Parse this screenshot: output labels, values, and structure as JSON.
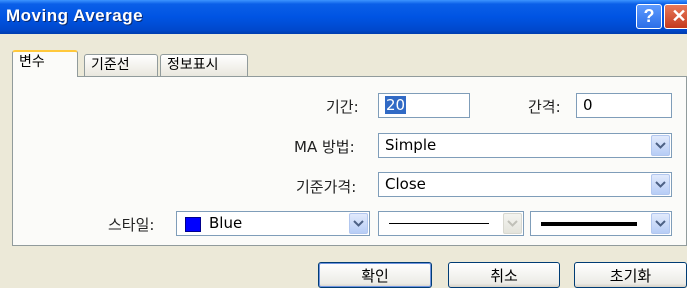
{
  "window": {
    "title": "Moving Average",
    "help_label": "?",
    "close_label": "✕"
  },
  "tabs": [
    {
      "label": "변수",
      "active": true
    },
    {
      "label": "기준선",
      "active": false
    },
    {
      "label": "정보표시",
      "active": false
    }
  ],
  "form": {
    "period_label": "기간:",
    "period_value": "20",
    "interval_label": "간격:",
    "interval_value": "0",
    "ma_method_label": "MA 방법:",
    "ma_method_value": "Simple",
    "base_price_label": "기준가격:",
    "base_price_value": "Close",
    "style_label": "스타일:",
    "color_value": "Blue",
    "color_hex": "#0000ff"
  },
  "buttons": {
    "ok": "확인",
    "cancel": "취소",
    "reset": "초기화"
  },
  "icons": {
    "dropdown": "chevron-down-icon"
  }
}
